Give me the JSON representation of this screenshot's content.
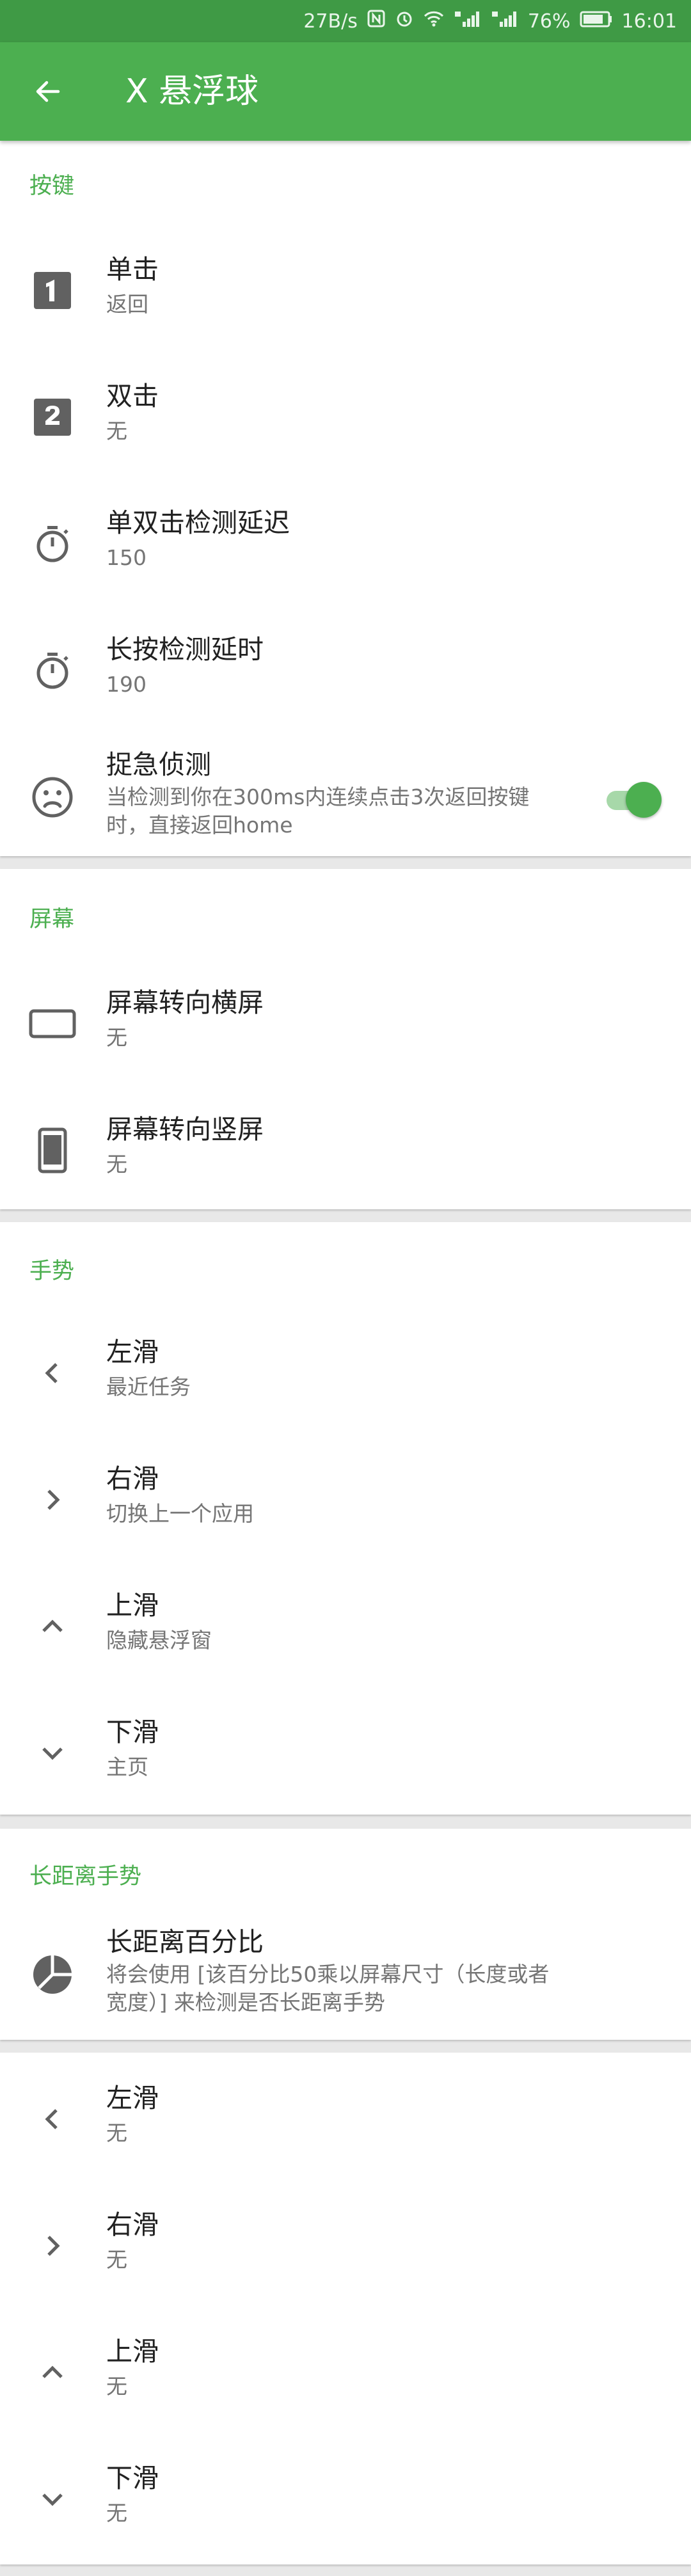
{
  "status_bar": {
    "speed": "27B/s",
    "icons": [
      "nfc-icon",
      "alarm-icon",
      "wifi-icon",
      "signal-4g-icon",
      "signal-2g-icon"
    ],
    "battery": "76%",
    "time": "16:01"
  },
  "app_bar": {
    "title": "X 悬浮球"
  },
  "sections": {
    "keys": {
      "header": "按键",
      "items": [
        {
          "title": "单击",
          "summary": "返回"
        },
        {
          "title": "双击",
          "summary": "无"
        },
        {
          "title": "单双击检测延迟",
          "summary": "150"
        },
        {
          "title": "长按检测延时",
          "summary": "190"
        },
        {
          "title": "捉急侦测",
          "summary": "当检测到你在300ms内连续点击3次返回按键时，直接返回home"
        }
      ]
    },
    "screen": {
      "header": "屏幕",
      "items": [
        {
          "title": "屏幕转向横屏",
          "summary": "无"
        },
        {
          "title": "屏幕转向竖屏",
          "summary": "无"
        }
      ]
    },
    "gestures": {
      "header": "手势",
      "items": [
        {
          "title": "左滑",
          "summary": "最近任务"
        },
        {
          "title": "右滑",
          "summary": "切换上一个应用"
        },
        {
          "title": "上滑",
          "summary": "隐藏悬浮窗"
        },
        {
          "title": "下滑",
          "summary": "主页"
        }
      ]
    },
    "long_gestures": {
      "header": "长距离手势",
      "items": [
        {
          "title": "长距离百分比",
          "summary": "将会使用 [该百分比50乘以屏幕尺寸（长度或者宽度）] 来检测是否长距离手势"
        }
      ]
    },
    "long_gestures_actions": {
      "items": [
        {
          "title": "左滑",
          "summary": "无"
        },
        {
          "title": "右滑",
          "summary": "无"
        },
        {
          "title": "上滑",
          "summary": "无"
        },
        {
          "title": "下滑",
          "summary": "无"
        }
      ]
    }
  },
  "toggle_state": {
    "panic_detection": true
  },
  "colors": {
    "accent": "#4caf50",
    "status_bar": "#3f9a45",
    "icon": "#616161"
  }
}
